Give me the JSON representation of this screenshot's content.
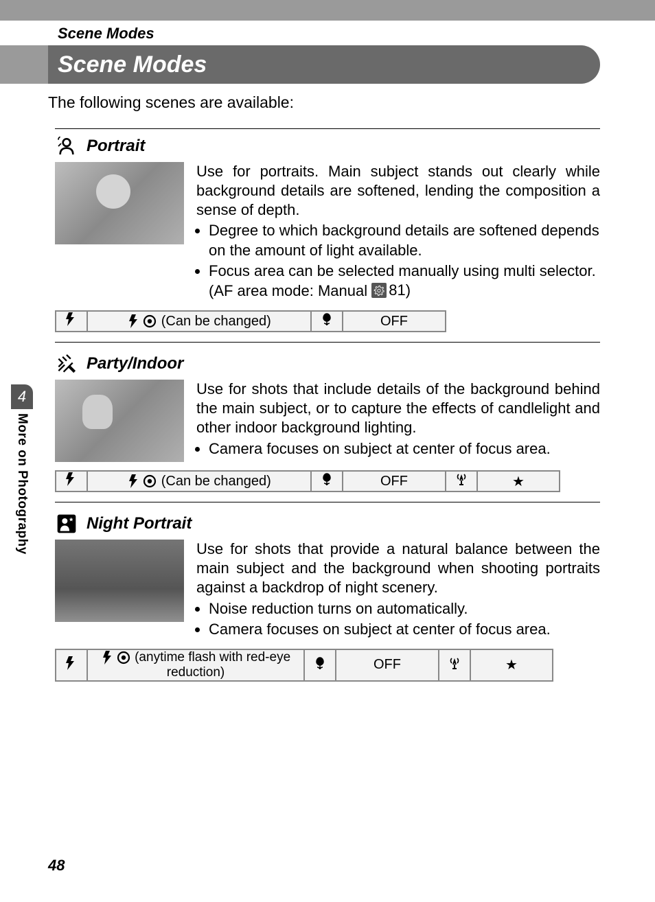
{
  "breadcrumb": "Scene Modes",
  "title": "Scene Modes",
  "intro": "The following scenes are available:",
  "side_tab": {
    "number": "4",
    "text": "More on Photography"
  },
  "page_number": "48",
  "sections": {
    "portrait": {
      "label": "Portrait",
      "desc": "Use for portraits. Main subject stands out clearly while background details are softened, lending the composition a sense of depth.",
      "bullets": [
        "Degree to which background details are softened depends on the amount of light available.",
        "Focus area can be selected manually using multi selector. (AF area mode: Manual "
      ],
      "page_ref": "81)",
      "settings": {
        "flash_value": "(Can be changed)",
        "macro_value": "OFF"
      }
    },
    "party": {
      "label": "Party/Indoor",
      "desc": "Use for shots that include details of the background behind the main subject, or to capture the effects of candlelight and other indoor background lighting.",
      "bullets": [
        "Camera focuses on subject at center of focus area."
      ],
      "settings": {
        "flash_value": "(Can be changed)",
        "macro_value": "OFF",
        "star": "★"
      }
    },
    "night": {
      "label": "Night Portrait",
      "desc": "Use for shots that provide a natural balance between the main subject and the background when shooting portraits against a backdrop of night scenery.",
      "bullets": [
        "Noise reduction turns on automatically.",
        "Camera focuses on subject at center of focus area."
      ],
      "settings": {
        "flash_value": "(anytime flash with red-eye reduction)",
        "macro_value": "OFF",
        "star": "★"
      }
    }
  }
}
